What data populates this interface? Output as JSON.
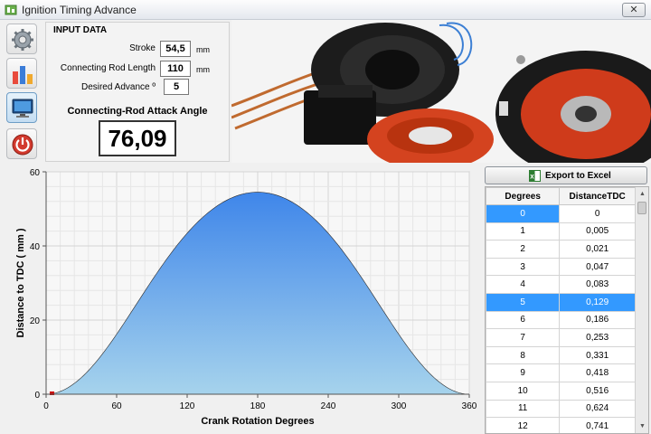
{
  "window": {
    "title": "Ignition Timing Advance",
    "close_label": "✕"
  },
  "toolbar": [
    {
      "name": "settings-gear-icon"
    },
    {
      "name": "bar-chart-icon"
    },
    {
      "name": "monitor-icon"
    },
    {
      "name": "power-icon"
    }
  ],
  "input": {
    "group_title": "INPUT DATA",
    "stroke_label": "Stroke",
    "stroke_value": "54,5",
    "stroke_unit": "mm",
    "rod_label": "Connecting Rod Length",
    "rod_value": "110",
    "rod_unit": "mm",
    "advance_label": "Desired Advance º",
    "advance_value": "5"
  },
  "attack": {
    "label": "Connecting-Rod Attack Angle",
    "value": "76,09"
  },
  "export_label": "Export to Excel",
  "table": {
    "headers": [
      "Degrees",
      "DistanceTDC"
    ],
    "rows": [
      [
        "0",
        "0"
      ],
      [
        "1",
        "0,005"
      ],
      [
        "2",
        "0,021"
      ],
      [
        "3",
        "0,047"
      ],
      [
        "4",
        "0,083"
      ],
      [
        "5",
        "0,129"
      ],
      [
        "6",
        "0,186"
      ],
      [
        "7",
        "0,253"
      ],
      [
        "8",
        "0,331"
      ],
      [
        "9",
        "0,418"
      ],
      [
        "10",
        "0,516"
      ],
      [
        "11",
        "0,624"
      ],
      [
        "12",
        "0,741"
      ]
    ],
    "selected_row": 5
  },
  "colors": {
    "accent": "#3399ff",
    "fill_top": "#3f86ea",
    "fill_bottom": "#a6d3ec",
    "marker": "#cc0000"
  },
  "chart_data": {
    "type": "area",
    "xlabel": "Crank Rotation Degrees",
    "ylabel": "Distance to TDC ( mm )",
    "xlim": [
      0,
      360
    ],
    "ylim": [
      0,
      60
    ],
    "x_ticks": [
      0,
      60,
      120,
      180,
      240,
      300,
      360
    ],
    "y_ticks": [
      0,
      20,
      40,
      60
    ],
    "grid": true,
    "stroke_mm": 54.5,
    "rod_mm": 110,
    "marker_x": 5,
    "x": [
      0,
      30,
      60,
      90,
      120,
      150,
      180,
      210,
      240,
      270,
      300,
      330,
      360
    ],
    "y": [
      0,
      4.3,
      16.0,
      31.2,
      44.0,
      51.6,
      54.5,
      51.6,
      44.0,
      31.2,
      16.0,
      4.3,
      0
    ]
  }
}
